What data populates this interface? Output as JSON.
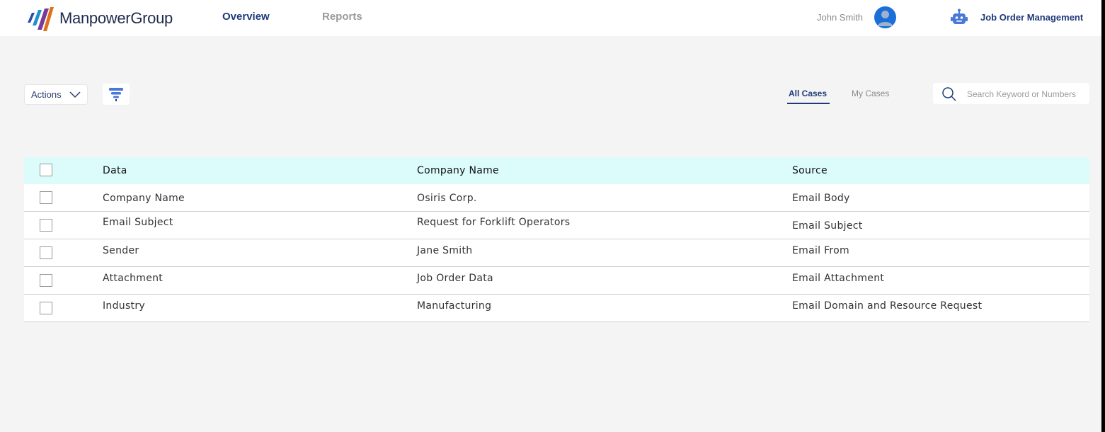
{
  "header": {
    "brand": "ManpowerGroup",
    "nav": [
      {
        "label": "Overview",
        "active": true
      },
      {
        "label": "Reports",
        "active": false
      }
    ],
    "user_name": "John Smith",
    "app_title": "Job Order Management"
  },
  "toolbar": {
    "actions_label": "Actions",
    "tabs": [
      {
        "label": "All Cases",
        "active": true
      },
      {
        "label": "My Cases",
        "active": false
      }
    ],
    "search_placeholder": "Search Keyword or Numbers"
  },
  "table": {
    "columns": [
      "Data",
      "Company Name",
      "Source"
    ],
    "rows": [
      {
        "data": "Company Name",
        "value": "Osiris Corp.",
        "source": "Email Body"
      },
      {
        "data": "Email Subject",
        "value": "Request for Forklift Operators",
        "source": "Email Subject"
      },
      {
        "data": "Sender",
        "value": "Jane Smith",
        "source": "Email From"
      },
      {
        "data": "Attachment",
        "value": "Job Order Data",
        "source": "Email Attachment"
      },
      {
        "data": "Industry",
        "value": "Manufacturing",
        "source": "Email Domain and Resource Request"
      }
    ]
  },
  "colors": {
    "primary": "#1f3a7a",
    "header_row_bg": "#dcfbfb",
    "page_bg": "#f4f4f4",
    "avatar_blue": "#1a6fd9",
    "filter_icon_blue": "#4a78d8"
  }
}
